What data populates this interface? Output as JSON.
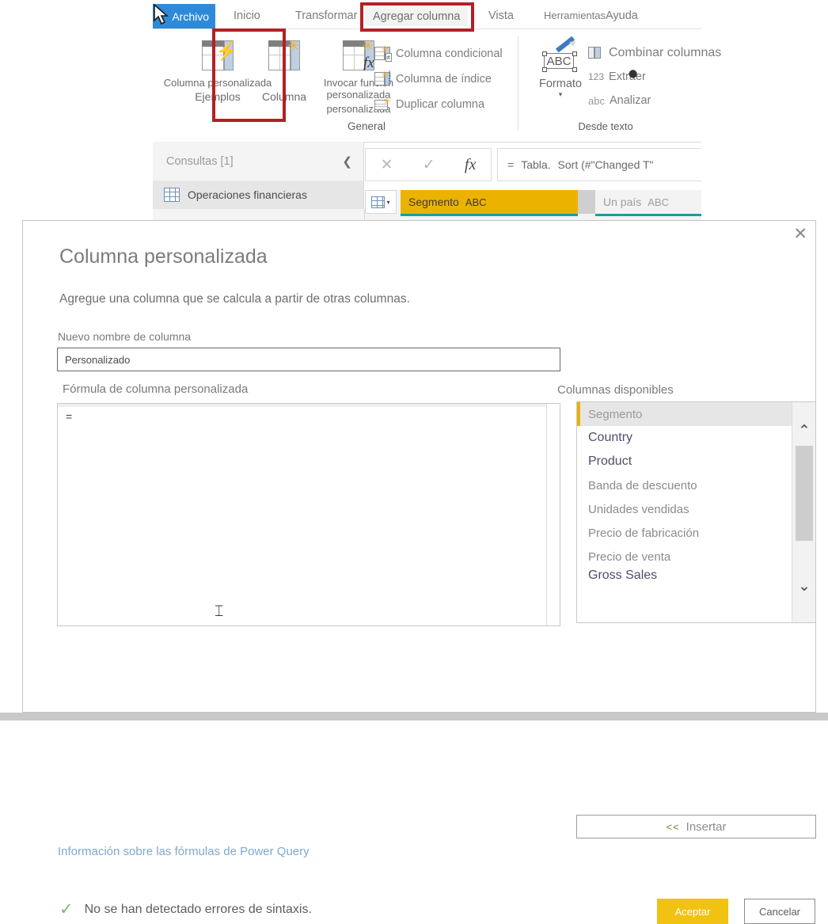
{
  "app": {
    "ribbon_tabs": [
      {
        "label": "Archivo",
        "name": "tab-archivo",
        "active": false
      },
      {
        "label": "Inicio",
        "name": "tab-inicio"
      },
      {
        "label": "Transformar",
        "name": "tab-transformar"
      },
      {
        "label": "Agregar columna",
        "name": "tab-agregar-columna",
        "highlighted": true
      },
      {
        "label": "Vista",
        "name": "tab-vista"
      },
      {
        "label": "Herramientas",
        "name": "tab-herramientas"
      },
      {
        "label": "Ayuda",
        "name": "tab-ayuda"
      }
    ],
    "ribbon": {
      "group_general_label": "General",
      "group_desde_texto_label": "Desde texto",
      "btn_col_from_examples_l1": "Columna personalizada",
      "btn_col_from_examples_l2": "Ejemplos",
      "btn_custom_column_l1": "",
      "btn_custom_column_l2": "Columna",
      "btn_invoke_fn_l1": "Invocar función personalizada",
      "btn_invoke_fn_l2": "personalizada",
      "item_conditional": "Columna condicional",
      "item_index": "Columna de índice",
      "item_duplicate": "Duplicar columna",
      "btn_format": "Formato",
      "format_abc": "ABC",
      "item_combine": "Combinar columnas",
      "item_extract": "Extraer",
      "item_extract_prefix": "123",
      "item_analyze": "Analizar",
      "item_analyze_prefix": "abc"
    },
    "queries_pane": {
      "title": "Consultas [1]",
      "collapse_icon": "chevron-left-icon",
      "items": [
        {
          "label": "Operaciones financieras"
        }
      ]
    },
    "formula_bar": {
      "cancel_icon": "cancel-icon",
      "accept_icon": "check-icon",
      "fx_icon": "fx-icon",
      "equals": "=",
      "value_part1": "Tabla.",
      "value_part2": "Sort (#\"Changed T\""
    },
    "grid": {
      "columns": [
        {
          "label": "Segmento",
          "type": "ABC",
          "selected": true
        },
        {
          "label": "Un país",
          "type": "ABC",
          "selected": false
        }
      ]
    }
  },
  "dialog": {
    "close_label": "✕",
    "title": "Columna personalizada",
    "subtitle": "Agregue una columna que se calcula a partir de otras columnas.",
    "name_label": "Nuevo nombre de columna",
    "name_value": "Personalizado",
    "formula_label": "Fórmula de columna personalizada",
    "formula_value": "=",
    "columns_label": "Columnas disponibles",
    "available_columns": [
      {
        "label": "Segmento",
        "selected": true,
        "style": "sel"
      },
      {
        "label": "Country",
        "style": "dark"
      },
      {
        "label": "Product",
        "style": "dark"
      },
      {
        "label": "Banda de descuento",
        "style": "normal"
      },
      {
        "label": "Unidades vendidas",
        "style": "normal"
      },
      {
        "label": "Precio de fabricación",
        "style": "normal"
      },
      {
        "label": "Precio de venta",
        "style": "normal"
      },
      {
        "label": "Gross Sales",
        "style": "clipped"
      }
    ],
    "scroll_up_icon": "chevron-up-icon",
    "scroll_down_icon": "chevron-down-icon",
    "insert_button": "Insertar",
    "insert_chevrons": "<<",
    "help_link": "Información sobre las fórmulas de Power Query",
    "status_icon": "check-icon",
    "status_text": "No se han detectado errores de sintaxis.",
    "ok_button": "Aceptar",
    "cancel_button": "Cancelar"
  },
  "colors": {
    "accent_yellow": "#F2C213",
    "grid_header_yellow": "#ECB200",
    "tab_blue": "#2E8AD8",
    "highlight_red": "#B42025",
    "teal_underline": "#13A0A0",
    "link_blue": "#7FA8CF",
    "success_green": "#7CB87C"
  }
}
